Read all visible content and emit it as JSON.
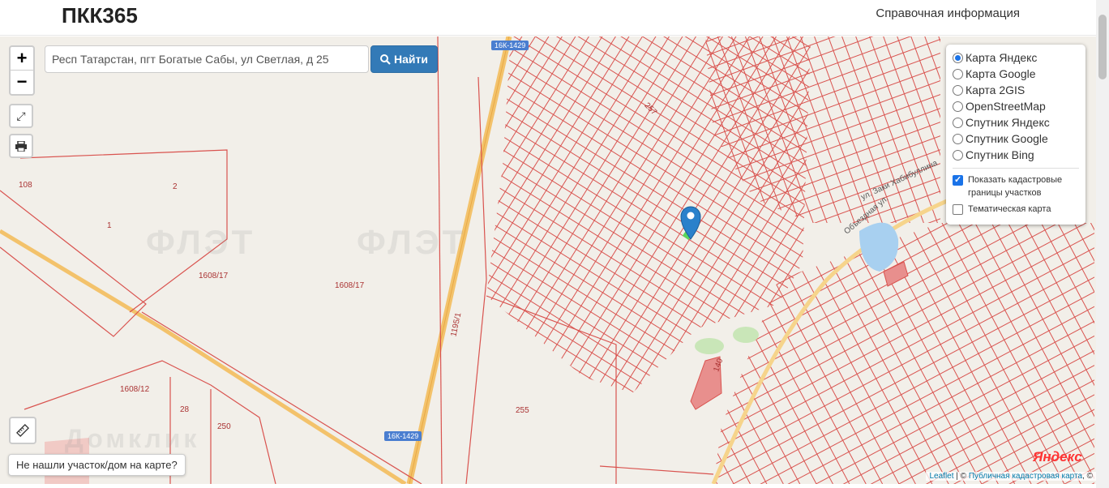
{
  "header": {
    "brand": "ПКК365",
    "nav_link": "Справочная информация"
  },
  "search": {
    "value": "Респ Татарстан, пгт Богатые Сабы, ул Светлая, д 25",
    "button_label": "Найти"
  },
  "zoom": {
    "in": "+",
    "out": "−"
  },
  "layers": {
    "options": [
      {
        "label": "Карта Яндекс",
        "selected": true
      },
      {
        "label": "Карта Google",
        "selected": false
      },
      {
        "label": "Карта 2GIS",
        "selected": false
      },
      {
        "label": "OpenStreetMap",
        "selected": false
      },
      {
        "label": "Спутник Яндекс",
        "selected": false
      },
      {
        "label": "Спутник Google",
        "selected": false
      },
      {
        "label": "Спутник Bing",
        "selected": false
      }
    ],
    "cadastral_label": "Показать кадастровые границы участков",
    "cadastral_checked": true,
    "thematic_label": "Тематическая карта",
    "thematic_checked": false
  },
  "map_labels": {
    "p108": "108",
    "p2": "2",
    "p1": "1",
    "p1608_17a": "1608/17",
    "p1608_17b": "1608/17",
    "p1608_12": "1608/12",
    "p28": "28",
    "p250": "250",
    "p255": "255",
    "p1195": "1195/1",
    "p257": "257",
    "p140": "140"
  },
  "road_shields": {
    "top": "16К-1429",
    "bottom": "16К-1429"
  },
  "street_labels": {
    "zaki": "ул. Заки Хабибуллина",
    "obezd": "Объездная ул."
  },
  "watermarks": {
    "w1": "ФЛЭТ",
    "w2": "ФЛЭТ",
    "w3": "Домклик"
  },
  "notfound_button": "Не нашли участок/дом на карте?",
  "attribution": {
    "leaflet": "Leaflet",
    "sep": " | © ",
    "pkk": "Публичная кадастровая карта",
    "tail": ", ©"
  },
  "yandex_logo": "Яндекс"
}
